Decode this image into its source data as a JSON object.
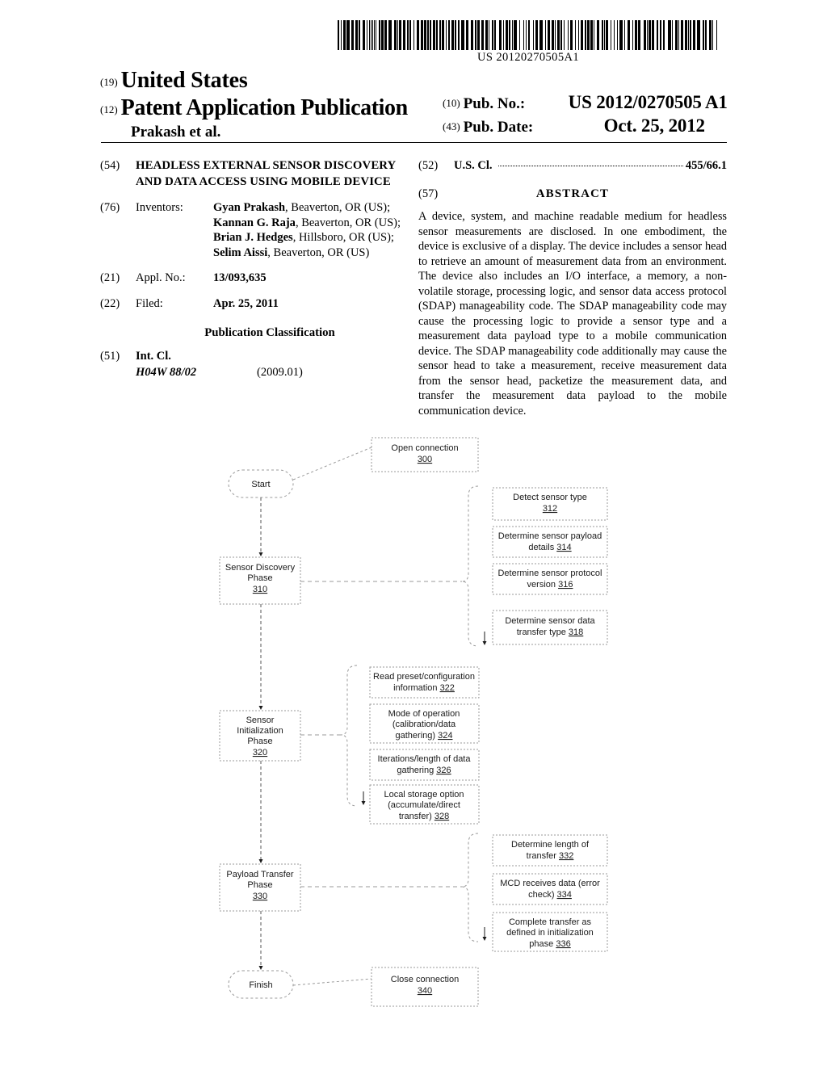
{
  "barcode": {
    "number": "US 20120270505A1"
  },
  "header": {
    "code_19": "(19)",
    "country": "United States",
    "code_12": "(12)",
    "doc_type": "Patent Application Publication",
    "authors": "Prakash et al.",
    "code_10": "(10)",
    "pub_no_label": "Pub. No.:",
    "pub_no_value": "US 2012/0270505 A1",
    "code_43": "(43)",
    "pub_date_label": "Pub. Date:",
    "pub_date_value": "Oct. 25, 2012"
  },
  "biblio": {
    "title_code": "(54)",
    "title": "HEADLESS EXTERNAL SENSOR DISCOVERY AND DATA ACCESS USING MOBILE DEVICE",
    "inventors_code": "(76)",
    "inventors_label": "Inventors:",
    "inventors": [
      {
        "name": "Gyan Prakash",
        "location": ", Beaverton, OR (US); "
      },
      {
        "name": "Kannan G. Raja",
        "location": ", Beaverton, OR (US); "
      },
      {
        "name": "Brian J. Hedges",
        "location": ", Hillsboro, OR (US); "
      },
      {
        "name": "Selim Aissi",
        "location": ", Beaverton, OR (US)"
      }
    ],
    "appl_no_code": "(21)",
    "appl_no_label": "Appl. No.:",
    "appl_no_value": "13/093,635",
    "filed_code": "(22)",
    "filed_label": "Filed:",
    "filed_value": "Apr. 25, 2011",
    "pub_classification_heading": "Publication Classification",
    "int_cl_code": "(51)",
    "int_cl_label": "Int. Cl.",
    "int_cl_symbol": "H04W 88/02",
    "int_cl_version": "(2009.01)"
  },
  "right_column": {
    "us_cl_code": "(52)",
    "us_cl_label": "U.S. Cl.",
    "us_cl_value": "455/66.1",
    "abstract_code": "(57)",
    "abstract_title": "ABSTRACT",
    "abstract_text": "A device, system, and machine readable medium for headless sensor measurements are disclosed. In one embodiment, the device is exclusive of a display. The device includes a sensor head to retrieve an amount of measurement data from an environment. The device also includes an I/O interface, a memory, a non-volatile storage, processing logic, and sensor data access protocol (SDAP) manageability code. The SDAP manageability code may cause the processing logic to provide a sensor type and a measurement data payload type to a mobile communication device. The SDAP manageability code additionally may cause the sensor head to take a measurement, receive measurement data from the sensor head, packetize the measurement data, and transfer the measurement data payload to the mobile communication device."
  },
  "flowchart": {
    "start_node": "Start",
    "finish_node": "Finish",
    "open_connection": {
      "line1": "Open connection",
      "ref": "300"
    },
    "close_connection": {
      "line1": "Close connection",
      "ref": "340"
    },
    "phase_discovery": {
      "line1": "Sensor Discovery",
      "line2": "Phase",
      "ref": "310"
    },
    "phase_initialization": {
      "line1": "Sensor",
      "line2": "Initialization",
      "line3": "Phase",
      "ref": "320"
    },
    "phase_payload": {
      "line1": "Payload Transfer",
      "line2": "Phase",
      "ref": "330"
    },
    "discovery_details": [
      {
        "lines": [
          "Detect sensor type"
        ],
        "ref": "312",
        "ref_on_own_line": true
      },
      {
        "lines": [
          "Determine sensor payload",
          "details "
        ],
        "ref": "314",
        "ref_on_own_line": false
      },
      {
        "lines": [
          "Determine sensor protocol",
          "version "
        ],
        "ref": "316",
        "ref_on_own_line": false
      },
      {
        "lines": [
          "Determine sensor data",
          "transfer type "
        ],
        "ref": "318",
        "ref_on_own_line": false
      }
    ],
    "initialization_details": [
      {
        "lines": [
          "Read preset/configuration",
          "information "
        ],
        "ref": "322",
        "ref_on_own_line": false
      },
      {
        "lines": [
          "Mode of operation",
          "(calibration/data",
          "gathering) "
        ],
        "ref": "324",
        "ref_on_own_line": false
      },
      {
        "lines": [
          "Iterations/length of data",
          "gathering "
        ],
        "ref": "326",
        "ref_on_own_line": false
      },
      {
        "lines": [
          "Local storage option",
          "(accumulate/direct",
          "transfer) "
        ],
        "ref": "328",
        "ref_on_own_line": false
      }
    ],
    "payload_details": [
      {
        "lines": [
          "Determine length of",
          "transfer "
        ],
        "ref": "332",
        "ref_on_own_line": false
      },
      {
        "lines": [
          "MCD receives data (error",
          "check) "
        ],
        "ref": "334",
        "ref_on_own_line": false
      },
      {
        "lines": [
          "Complete transfer as",
          "defined in initialization",
          "phase "
        ],
        "ref": "336",
        "ref_on_own_line": false
      }
    ]
  }
}
